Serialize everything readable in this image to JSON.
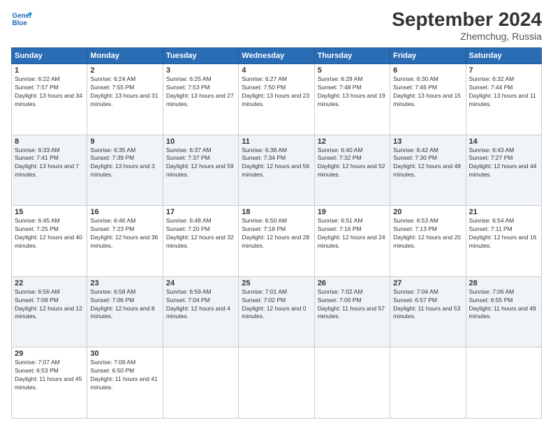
{
  "header": {
    "logo_line1": "General",
    "logo_line2": "Blue",
    "title": "September 2024",
    "subtitle": "Zhemchug, Russia"
  },
  "days_of_week": [
    "Sunday",
    "Monday",
    "Tuesday",
    "Wednesday",
    "Thursday",
    "Friday",
    "Saturday"
  ],
  "weeks": [
    [
      {
        "day": 1,
        "sunrise": "6:22 AM",
        "sunset": "7:57 PM",
        "daylight": "13 hours and 34 minutes."
      },
      {
        "day": 2,
        "sunrise": "6:24 AM",
        "sunset": "7:55 PM",
        "daylight": "13 hours and 31 minutes."
      },
      {
        "day": 3,
        "sunrise": "6:25 AM",
        "sunset": "7:53 PM",
        "daylight": "13 hours and 27 minutes."
      },
      {
        "day": 4,
        "sunrise": "6:27 AM",
        "sunset": "7:50 PM",
        "daylight": "13 hours and 23 minutes."
      },
      {
        "day": 5,
        "sunrise": "6:29 AM",
        "sunset": "7:48 PM",
        "daylight": "13 hours and 19 minutes."
      },
      {
        "day": 6,
        "sunrise": "6:30 AM",
        "sunset": "7:46 PM",
        "daylight": "13 hours and 15 minutes."
      },
      {
        "day": 7,
        "sunrise": "6:32 AM",
        "sunset": "7:44 PM",
        "daylight": "13 hours and 11 minutes."
      }
    ],
    [
      {
        "day": 8,
        "sunrise": "6:33 AM",
        "sunset": "7:41 PM",
        "daylight": "13 hours and 7 minutes."
      },
      {
        "day": 9,
        "sunrise": "6:35 AM",
        "sunset": "7:39 PM",
        "daylight": "13 hours and 3 minutes."
      },
      {
        "day": 10,
        "sunrise": "6:37 AM",
        "sunset": "7:37 PM",
        "daylight": "12 hours and 59 minutes."
      },
      {
        "day": 11,
        "sunrise": "6:38 AM",
        "sunset": "7:34 PM",
        "daylight": "12 hours and 56 minutes."
      },
      {
        "day": 12,
        "sunrise": "6:40 AM",
        "sunset": "7:32 PM",
        "daylight": "12 hours and 52 minutes."
      },
      {
        "day": 13,
        "sunrise": "6:42 AM",
        "sunset": "7:30 PM",
        "daylight": "12 hours and 48 minutes."
      },
      {
        "day": 14,
        "sunrise": "6:43 AM",
        "sunset": "7:27 PM",
        "daylight": "12 hours and 44 minutes."
      }
    ],
    [
      {
        "day": 15,
        "sunrise": "6:45 AM",
        "sunset": "7:25 PM",
        "daylight": "12 hours and 40 minutes."
      },
      {
        "day": 16,
        "sunrise": "6:46 AM",
        "sunset": "7:23 PM",
        "daylight": "12 hours and 36 minutes."
      },
      {
        "day": 17,
        "sunrise": "6:48 AM",
        "sunset": "7:20 PM",
        "daylight": "12 hours and 32 minutes."
      },
      {
        "day": 18,
        "sunrise": "6:50 AM",
        "sunset": "7:18 PM",
        "daylight": "12 hours and 28 minutes."
      },
      {
        "day": 19,
        "sunrise": "6:51 AM",
        "sunset": "7:16 PM",
        "daylight": "12 hours and 24 minutes."
      },
      {
        "day": 20,
        "sunrise": "6:53 AM",
        "sunset": "7:13 PM",
        "daylight": "12 hours and 20 minutes."
      },
      {
        "day": 21,
        "sunrise": "6:54 AM",
        "sunset": "7:11 PM",
        "daylight": "12 hours and 16 minutes."
      }
    ],
    [
      {
        "day": 22,
        "sunrise": "6:56 AM",
        "sunset": "7:09 PM",
        "daylight": "12 hours and 12 minutes."
      },
      {
        "day": 23,
        "sunrise": "6:58 AM",
        "sunset": "7:06 PM",
        "daylight": "12 hours and 8 minutes."
      },
      {
        "day": 24,
        "sunrise": "6:59 AM",
        "sunset": "7:04 PM",
        "daylight": "12 hours and 4 minutes."
      },
      {
        "day": 25,
        "sunrise": "7:01 AM",
        "sunset": "7:02 PM",
        "daylight": "12 hours and 0 minutes."
      },
      {
        "day": 26,
        "sunrise": "7:02 AM",
        "sunset": "7:00 PM",
        "daylight": "11 hours and 57 minutes."
      },
      {
        "day": 27,
        "sunrise": "7:04 AM",
        "sunset": "6:57 PM",
        "daylight": "11 hours and 53 minutes."
      },
      {
        "day": 28,
        "sunrise": "7:06 AM",
        "sunset": "6:55 PM",
        "daylight": "11 hours and 49 minutes."
      }
    ],
    [
      {
        "day": 29,
        "sunrise": "7:07 AM",
        "sunset": "6:53 PM",
        "daylight": "11 hours and 45 minutes."
      },
      {
        "day": 30,
        "sunrise": "7:09 AM",
        "sunset": "6:50 PM",
        "daylight": "11 hours and 41 minutes."
      },
      null,
      null,
      null,
      null,
      null
    ]
  ]
}
